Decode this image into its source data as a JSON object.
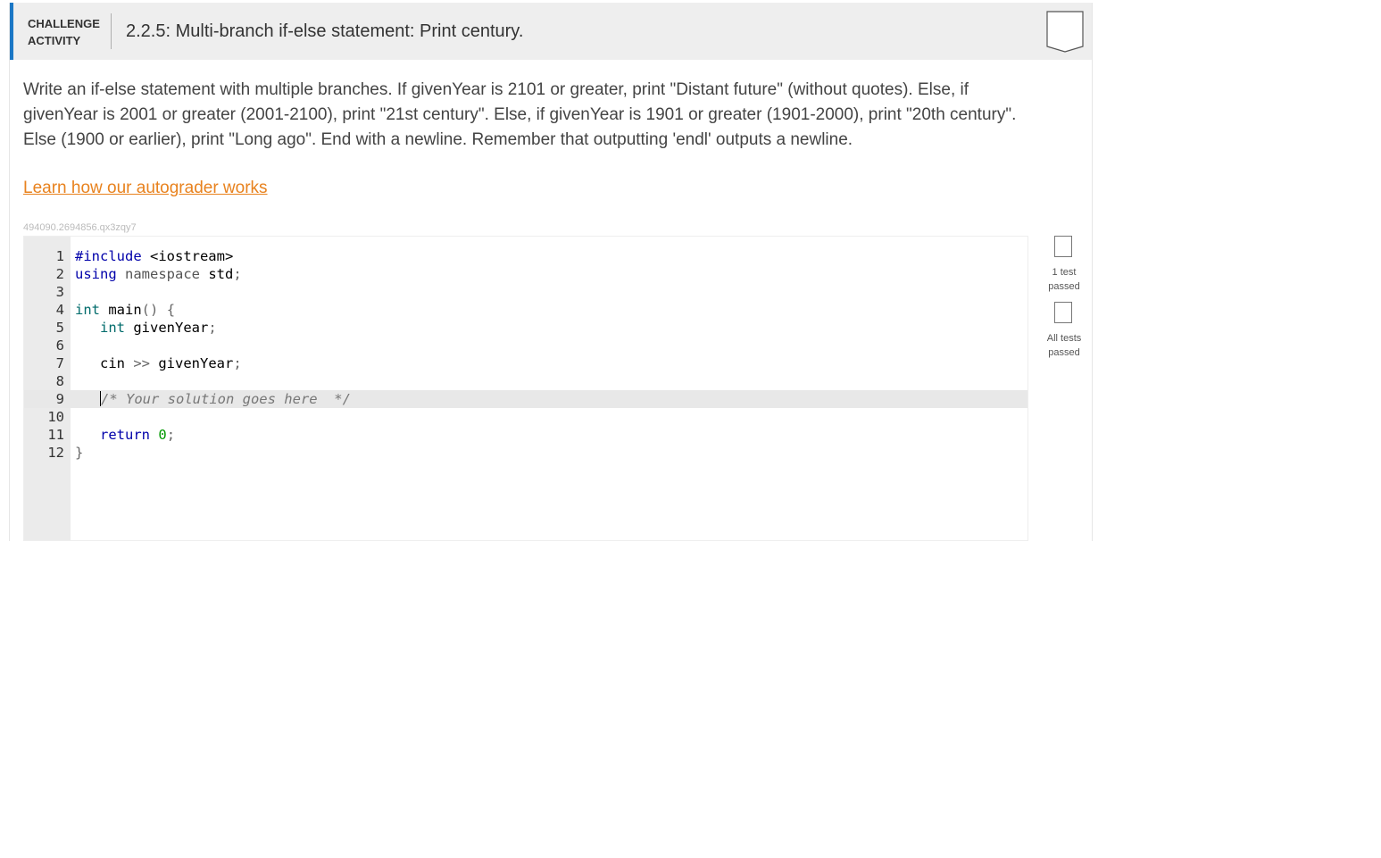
{
  "header": {
    "type_line1": "CHALLENGE",
    "type_line2": "ACTIVITY",
    "title": "2.2.5: Multi-branch if-else statement: Print century.",
    "accent_color": "#1b77c5",
    "completion_icon": "bookmark-outline-icon"
  },
  "description": "Write an if-else statement with multiple branches. If givenYear is 2101 or greater, print \"Distant future\" (without quotes). Else, if givenYear is 2001 or greater (2001-2100), print \"21st century\". Else, if givenYear is 1901 or greater (1901-2000), print \"20th century\". Else (1900 or earlier), print \"Long ago\". End with a newline. Remember that outputting 'endl' outputs a newline.",
  "grader_link": "Learn how our autograder works",
  "activity_id": "494090.2694856.qx3zqy7",
  "editor": {
    "active_line": 9,
    "lines": [
      {
        "n": "1",
        "text": "#include <iostream>"
      },
      {
        "n": "2",
        "text": "using namespace std;"
      },
      {
        "n": "3",
        "text": ""
      },
      {
        "n": "4",
        "text": "int main() {"
      },
      {
        "n": "5",
        "text": "   int givenYear;"
      },
      {
        "n": "6",
        "text": ""
      },
      {
        "n": "7",
        "text": "   cin >> givenYear;"
      },
      {
        "n": "8",
        "text": ""
      },
      {
        "n": "9",
        "text": "   /* Your solution goes here  */"
      },
      {
        "n": "10",
        "text": ""
      },
      {
        "n": "11",
        "text": "   return 0;"
      },
      {
        "n": "12",
        "text": "}"
      }
    ]
  },
  "tests": {
    "one_test": {
      "line1": "1 test",
      "line2": "passed",
      "icon": "test-status-box-icon"
    },
    "all_tests": {
      "line1": "All tests",
      "line2": "passed",
      "icon": "test-status-box-icon"
    }
  }
}
